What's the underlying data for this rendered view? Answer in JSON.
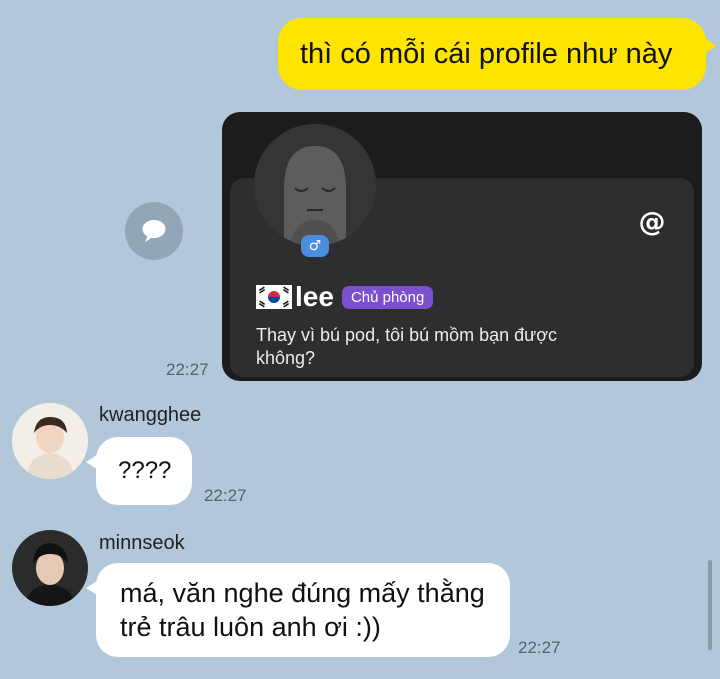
{
  "messages": {
    "outgoing_text": "thì có mỗi cái profile như này",
    "profile_card": {
      "name": "lee",
      "badge": "Chủ phòng",
      "status": "Thay vì bú pod, tôi bú mồm bạn được không?",
      "gender_symbol": "♂",
      "mention_symbol": "@",
      "time": "22:27"
    },
    "incoming": [
      {
        "sender": "kwangghee",
        "text": "????",
        "time": "22:27"
      },
      {
        "sender": "minnseok",
        "text": "má, văn nghe đúng mấy thằng trẻ trâu luôn anh ơi :))",
        "time": "22:27"
      }
    ]
  },
  "icons": {
    "share": "share-chat-bubble-icon",
    "flag": "south-korea-flag-icon",
    "gender": "male-gender-icon",
    "mention": "at-mention-icon"
  },
  "colors": {
    "background": "#b2c7da",
    "outgoing_bubble": "#fee500",
    "incoming_bubble": "#ffffff",
    "card": "#1c1c1e",
    "badge": "#7b4fcf"
  }
}
